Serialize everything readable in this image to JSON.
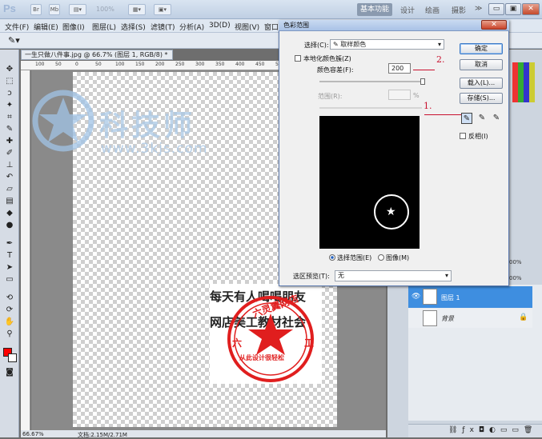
{
  "app": {
    "logo": "Ps",
    "zoom": "100%",
    "workspace_active": "基本功能",
    "workspaces": [
      "设计",
      "绘画",
      "摄影"
    ],
    "more": "≫"
  },
  "menu": [
    "文件(F)",
    "编辑(E)",
    "图像(I)",
    "图层(L)",
    "选择(S)",
    "滤镜(T)",
    "分析(A)",
    "3D(D)",
    "视图(V)",
    "窗口"
  ],
  "document": {
    "tab_title": "一生只做八件事.jpg @ 66.7% (图层 1, RGB/8) *",
    "ruler_ticks": [
      "100",
      "50",
      "0",
      "50",
      "100",
      "150",
      "200",
      "250",
      "300",
      "350",
      "400",
      "450",
      "500",
      "550"
    ],
    "text_line1": "每天有人喝喝朋友",
    "text_line2": "网店美工教材社会",
    "stamp_top": "六灵翼网店",
    "stamp_side_left": "六",
    "stamp_side_right": "工",
    "stamp_bottom": "从此设计很轻松",
    "zoom_status": "66.67%",
    "doc_status": "文档:2.15M/2.71M"
  },
  "watermark": {
    "title": "科技师",
    "url": "www.3kjs.com"
  },
  "dialog": {
    "title": "色彩范围",
    "close": "✕",
    "select_label": "选择(C):",
    "select_value": "取样颜色",
    "localized_label": "本地化颜色簇(Z)",
    "fuzziness_label": "颜色容差(F):",
    "fuzziness_value": "200",
    "range_label": "范围(R):",
    "range_unit": "%",
    "radio_selection": "选择范围(E)",
    "radio_image": "图像(M)",
    "preview_label": "选区预览(T):",
    "preview_value": "无",
    "buttons": {
      "ok": "确定",
      "cancel": "取消",
      "load": "载入(L)...",
      "save": "存储(S)..."
    },
    "invert_label": "反相(I)"
  },
  "annotations": {
    "one": "1.",
    "two": "2."
  },
  "layers": {
    "opacity": "00%",
    "fill": "00%",
    "items": [
      {
        "name": "图层 1"
      },
      {
        "name": "背景"
      }
    ]
  },
  "colors": {
    "accent": "#3e8ee0",
    "stamp_red": "#e01e1e",
    "foreground": "#ff0000"
  }
}
